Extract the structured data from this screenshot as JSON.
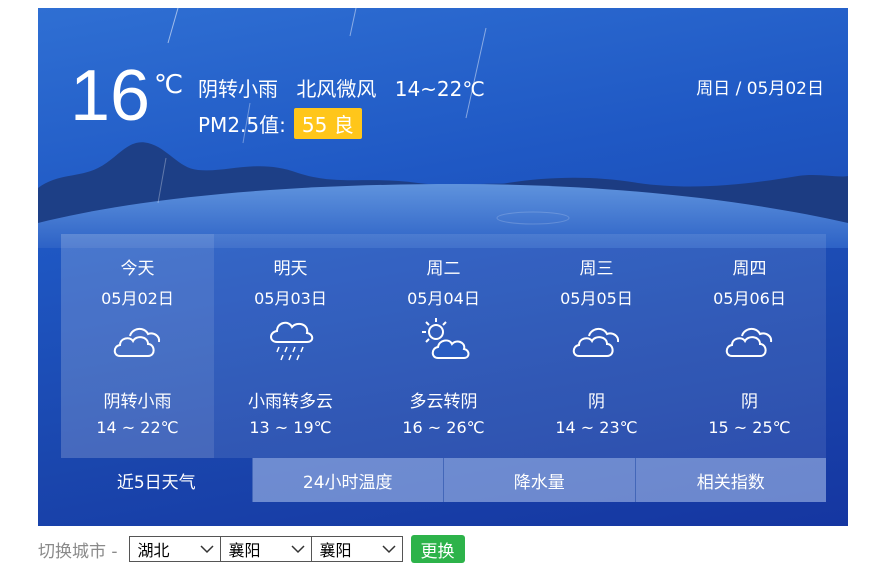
{
  "current": {
    "temperature": "16",
    "unit": "℃",
    "condition": "阴转小雨",
    "wind": "北风微风",
    "range": "14~22℃",
    "pm_label": "PM2.5值:",
    "aqi_value": "55",
    "aqi_level": "良",
    "aqi_color": "#ffc61a",
    "date": "周日 / 05月02日"
  },
  "forecast": [
    {
      "name": "今天",
      "date": "05月02日",
      "icon": "cloudy-icon",
      "condition": "阴转小雨",
      "range": "14 ~ 22℃"
    },
    {
      "name": "明天",
      "date": "05月03日",
      "icon": "rain-cloud-icon",
      "condition": "小雨转多云",
      "range": "13 ~ 19℃"
    },
    {
      "name": "周二",
      "date": "05月04日",
      "icon": "partly-sunny-icon",
      "condition": "多云转阴",
      "range": "16 ~ 26℃"
    },
    {
      "name": "周三",
      "date": "05月05日",
      "icon": "cloudy-icon",
      "condition": "阴",
      "range": "14 ~ 23℃"
    },
    {
      "name": "周四",
      "date": "05月06日",
      "icon": "cloudy-icon",
      "condition": "阴",
      "range": "15 ~ 25℃"
    }
  ],
  "tabs": [
    "近5日天气",
    "24小时温度",
    "降水量",
    "相关指数"
  ],
  "switcher": {
    "label": "切换城市 -",
    "province": "湖北",
    "city": "襄阳",
    "district": "襄阳",
    "button": "更换",
    "button_color": "#2db34a"
  }
}
